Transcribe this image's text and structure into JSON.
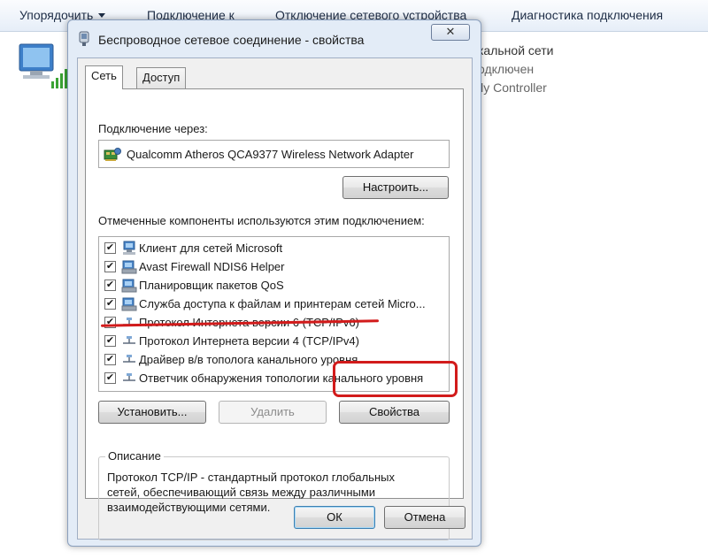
{
  "toolbar": {
    "organize": "Упорядочить",
    "connect": "Подключение к",
    "disable": "Отключение сетевого устройства",
    "diagnose": "Диагностика подключения"
  },
  "background": {
    "title_partial": "кальной сети",
    "status_partial": "одключен",
    "adapter_partial": "ily Controller"
  },
  "dialog": {
    "title": "Беспроводное сетевое соединение - свойства",
    "close_label": "✕",
    "tabs": [
      {
        "label": "Сеть",
        "active": true
      },
      {
        "label": "Доступ",
        "active": false
      }
    ],
    "connect_using_label": "Подключение через:",
    "adapter_name": "Qualcomm Atheros QCA9377 Wireless Network Adapter",
    "configure_label": "Настроить...",
    "components_label": "Отмеченные компоненты используются этим подключением:",
    "components": [
      {
        "label": "Клиент для сетей Microsoft",
        "checked": true,
        "icon": "network-client-icon"
      },
      {
        "label": "Avast Firewall NDIS6 Helper",
        "checked": true,
        "icon": "network-service-icon"
      },
      {
        "label": "Планировщик пакетов QoS",
        "checked": true,
        "icon": "network-service-icon"
      },
      {
        "label": "Служба доступа к файлам и принтерам сетей Micro...",
        "checked": true,
        "icon": "network-service-icon"
      },
      {
        "label": "Протокол Интернета версии 6 (TCP/IPv6)",
        "checked": true,
        "icon": "protocol-icon"
      },
      {
        "label": "Протокол Интернета версии 4 (TCP/IPv4)",
        "checked": true,
        "icon": "protocol-icon"
      },
      {
        "label": "Драйвер в/в тополога канального уровня",
        "checked": true,
        "icon": "protocol-icon"
      },
      {
        "label": "Ответчик обнаружения топологии канального уровня",
        "checked": true,
        "icon": "protocol-icon"
      }
    ],
    "install_label": "Установить...",
    "uninstall_label": "Удалить",
    "properties_label": "Свойства",
    "description_title": "Описание",
    "description_text": "Протокол TCP/IP - стандартный протокол глобальных\nсетей, обеспечивающий связь между различными\nвзаимодействующими сетями.",
    "ok_label": "ОК",
    "cancel_label": "Отмена"
  },
  "colors": {
    "highlight_red": "#d21b1b",
    "title_bar": "#e3ecf7"
  }
}
